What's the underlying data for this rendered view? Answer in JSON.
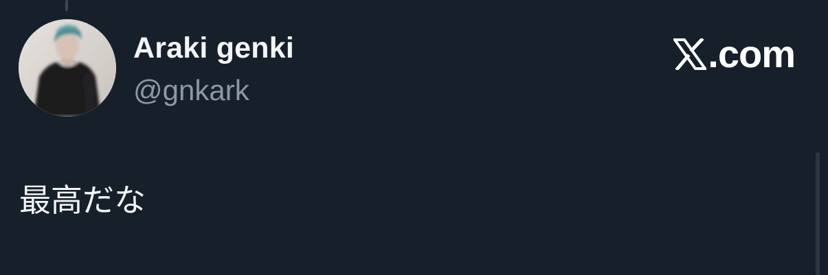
{
  "author": {
    "display_name": "Araki genki",
    "handle": "@gnkark"
  },
  "brand": {
    "text": ".com",
    "icon": "x-logo-icon"
  },
  "tweet": {
    "text": "最高だな"
  },
  "colors": {
    "background": "#17202a",
    "primary_text": "#f2f4f6",
    "secondary_text": "#8b98a5"
  }
}
